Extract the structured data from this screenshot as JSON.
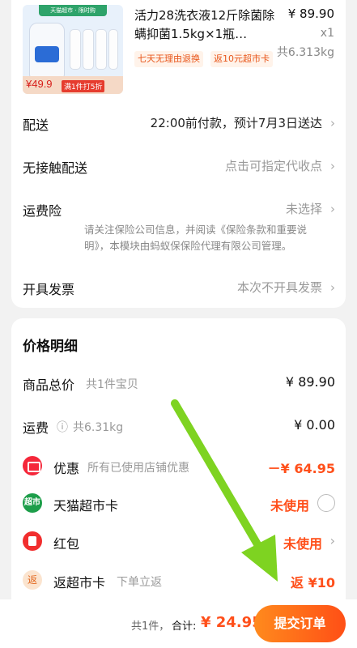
{
  "product": {
    "thumb_top_text": "天猫超市 · 限时购",
    "thumb_price": "¥49.9",
    "thumb_discount": "满1件打5折",
    "title": "活力28洗衣液12斤除菌除螨抑菌1.5kg×1瓶…",
    "price": "¥ 89.90",
    "qty": "x1",
    "weight": "共6.313kg",
    "tags": [
      "七天无理由退换",
      "返10元超市卡"
    ]
  },
  "shipping": {
    "delivery_label": "配送",
    "delivery_value": "22:00前付款，预计7月3日送达",
    "contactless_label": "无接触配送",
    "contactless_value": "点击可指定代收点",
    "insurance_label": "运费险",
    "insurance_value": "未选择",
    "insurance_note": "请关注保险公司信息，并阅读《保险条款和重要说明》，本模块由蚂蚁保保险代理有限公司管理。",
    "invoice_label": "开具发票",
    "invoice_value": "本次不开具发票"
  },
  "price_detail": {
    "title": "价格明细",
    "goods_label": "商品总价",
    "goods_sub": "共1件宝贝",
    "goods_amount": "¥ 89.90",
    "freight_label": "运费",
    "freight_sub": "共6.31kg",
    "freight_amount": "¥ 0.00",
    "discount_label": "优惠",
    "discount_sub": "所有已使用店铺优惠",
    "discount_amount": "－¥ 64.95",
    "tmall_card_icon": "超市",
    "tmall_card_label": "天猫超市卡",
    "tmall_card_value": "未使用",
    "redpacket_label": "红包",
    "redpacket_value": "未使用",
    "rebate_icon": "返",
    "rebate_label": "返超市卡",
    "rebate_sub": "下单立返",
    "rebate_value": "返 ¥10"
  },
  "footer": {
    "count": "共1件，",
    "total_label": "合计:",
    "total": "¥ 24.95",
    "submit": "提交订单"
  },
  "colors": {
    "accent": "#ff4f1a",
    "arrow": "#7ed321"
  }
}
